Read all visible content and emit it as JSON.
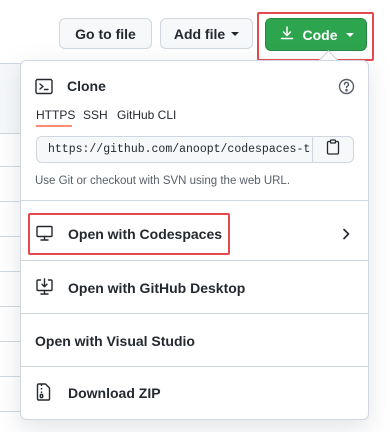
{
  "toolbar": {
    "goto_file_label": "Go to file",
    "add_file_label": "Add file",
    "code_label": "Code"
  },
  "clone": {
    "title": "Clone",
    "tabs": [
      {
        "label": "HTTPS",
        "selected": true
      },
      {
        "label": "SSH",
        "selected": false
      },
      {
        "label": "GitHub CLI",
        "selected": false
      }
    ],
    "url": "https://github.com/anoopt/codespaces-t",
    "hint": "Use Git or checkout with SVN using the web URL."
  },
  "menu": {
    "open_codespaces": "Open with Codespaces",
    "open_desktop": "Open with GitHub Desktop",
    "open_visual_studio": "Open with Visual Studio",
    "download_zip": "Download ZIP"
  },
  "icons": {
    "terminal": "terminal-icon",
    "help": "question-circle-icon",
    "copy": "clipboard-icon",
    "codespaces": "monitor-icon",
    "desktop": "desktop-download-icon",
    "zip": "file-zip-icon",
    "chevron": "chevron-right-icon",
    "download": "download-icon"
  },
  "colors": {
    "primary_button": "#2da44e",
    "highlight_box": "#e5484d",
    "tab_underline": "#fd8c73",
    "border": "#d0d7de",
    "muted_text": "#57606a"
  }
}
